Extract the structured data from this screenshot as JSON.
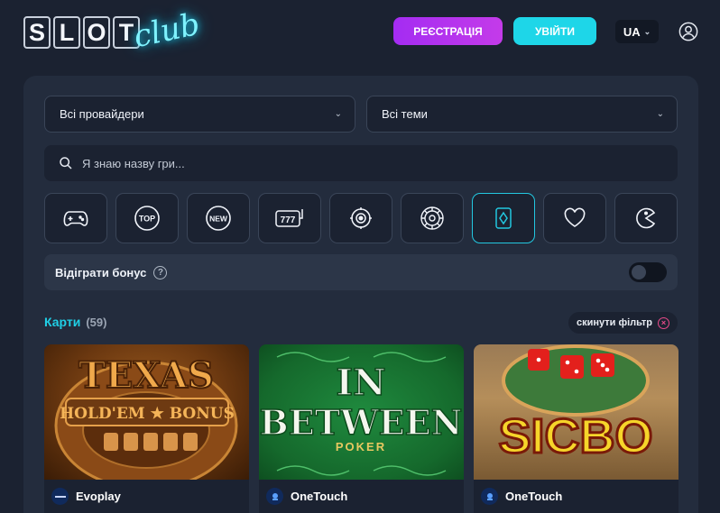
{
  "header": {
    "logo_slot_letters": [
      "S",
      "L",
      "O",
      "T"
    ],
    "logo_club": "club",
    "register_label": "Реєстрація",
    "login_label": "Увійти",
    "language": "UA"
  },
  "filters": {
    "providers_label": "Всі провайдери",
    "themes_label": "Всі теми",
    "search_placeholder": "Я знаю назву гри..."
  },
  "categories": [
    {
      "icon": "gamepad-icon",
      "active": false
    },
    {
      "icon": "top-icon",
      "text": "TOP",
      "active": false
    },
    {
      "icon": "new-icon",
      "text": "NEW",
      "active": false
    },
    {
      "icon": "slot-machine-icon",
      "text": "777",
      "active": false
    },
    {
      "icon": "target-icon",
      "active": false
    },
    {
      "icon": "roulette-icon",
      "active": false
    },
    {
      "icon": "cards-icon",
      "active": true
    },
    {
      "icon": "heart-icon",
      "active": false
    },
    {
      "icon": "pacman-icon",
      "active": false
    }
  ],
  "bonus": {
    "label": "Відіграти бонус",
    "help_glyph": "?",
    "enabled": false
  },
  "section": {
    "title": "Карти",
    "count": "(59)",
    "reset_label": "скинути фільтр",
    "reset_glyph": "×"
  },
  "games": [
    {
      "title": "Texas Hold'em Bonus",
      "art_line1": "TEXAS",
      "art_line2": "HOLD'EM ★ BONUS",
      "provider": "Evoplay"
    },
    {
      "title": "In Between Poker",
      "art_line1": "IN",
      "art_line2": "BETWEEN",
      "art_line3": "POKER",
      "provider": "OneTouch"
    },
    {
      "title": "SicBo",
      "art_line1": "SICBO",
      "provider": "OneTouch"
    }
  ],
  "colors": {
    "background": "#1b2231",
    "panel": "#232c3d",
    "accent_cyan": "#1ed6e8",
    "accent_purple": "#b033ef"
  }
}
